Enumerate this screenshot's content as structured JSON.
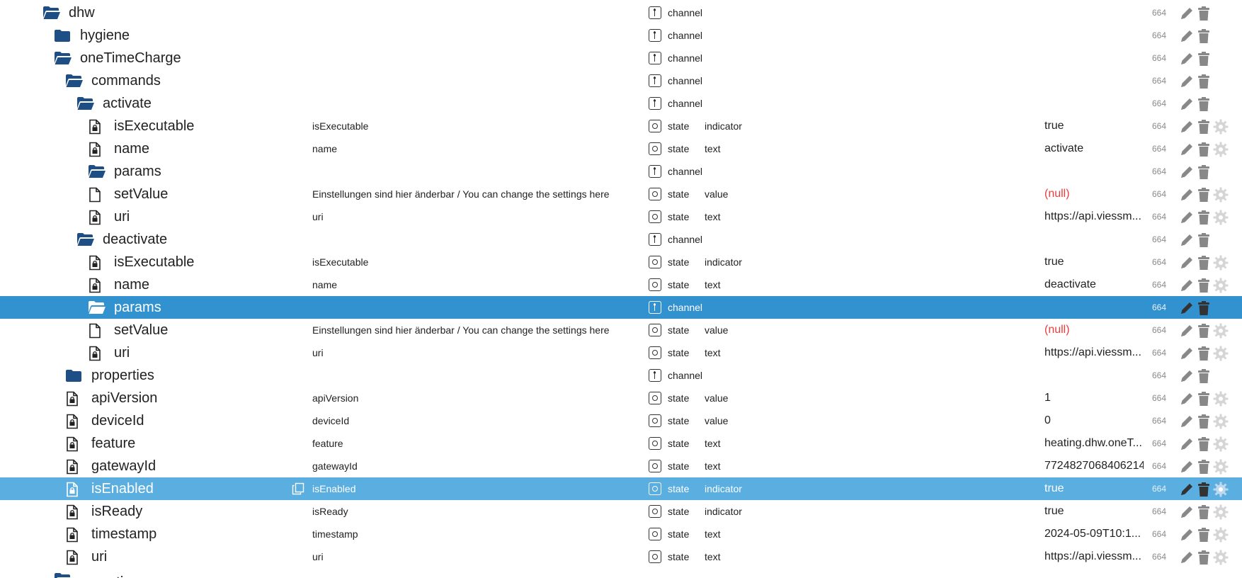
{
  "colors": {
    "folder": "#1d4f86",
    "selected_row": "#3291cf",
    "selected_row_light": "#5aaee0",
    "null_value": "#ee3b3b",
    "acl_text": "#8a8a8a",
    "action_icon": "#888888",
    "gear_icon": "#d6d6d6"
  },
  "rows": [
    {
      "name": "dhw",
      "icon": "folder-open",
      "indent": 0,
      "desc": "",
      "type": "channel",
      "role": "",
      "value": "",
      "acl": "664",
      "gear": false,
      "selected": ""
    },
    {
      "name": "hygiene",
      "icon": "folder-closed",
      "indent": 1,
      "desc": "",
      "type": "channel",
      "role": "",
      "value": "",
      "acl": "664",
      "gear": false,
      "selected": ""
    },
    {
      "name": "oneTimeCharge",
      "icon": "folder-open",
      "indent": 1,
      "desc": "",
      "type": "channel",
      "role": "",
      "value": "",
      "acl": "664",
      "gear": false,
      "selected": ""
    },
    {
      "name": "commands",
      "icon": "folder-open",
      "indent": 2,
      "desc": "",
      "type": "channel",
      "role": "",
      "value": "",
      "acl": "664",
      "gear": false,
      "selected": ""
    },
    {
      "name": "activate",
      "icon": "folder-open",
      "indent": 3,
      "desc": "",
      "type": "channel",
      "role": "",
      "value": "",
      "acl": "664",
      "gear": false,
      "selected": ""
    },
    {
      "name": "isExecutable",
      "icon": "file-lock",
      "indent": 4,
      "desc": "isExecutable",
      "type": "state",
      "role": "indicator",
      "value": "true",
      "acl": "664",
      "gear": true,
      "selected": ""
    },
    {
      "name": "name",
      "icon": "file-lock",
      "indent": 4,
      "desc": "name",
      "type": "state",
      "role": "text",
      "value": "activate",
      "acl": "664",
      "gear": true,
      "selected": ""
    },
    {
      "name": "params",
      "icon": "folder-open",
      "indent": 4,
      "desc": "",
      "type": "channel",
      "role": "",
      "value": "",
      "acl": "664",
      "gear": false,
      "selected": ""
    },
    {
      "name": "setValue",
      "icon": "file",
      "indent": 4,
      "desc": "Einstellungen sind hier änderbar / You can change the settings here",
      "type": "state",
      "role": "value",
      "value": "(null)",
      "valueNull": true,
      "acl": "664",
      "gear": true,
      "selected": ""
    },
    {
      "name": "uri",
      "icon": "file-lock",
      "indent": 4,
      "desc": "uri",
      "type": "state",
      "role": "text",
      "value": "https://api.viessm...",
      "acl": "664",
      "gear": true,
      "selected": ""
    },
    {
      "name": "deactivate",
      "icon": "folder-open",
      "indent": 3,
      "desc": "",
      "type": "channel",
      "role": "",
      "value": "",
      "acl": "664",
      "gear": false,
      "selected": ""
    },
    {
      "name": "isExecutable",
      "icon": "file-lock",
      "indent": 4,
      "desc": "isExecutable",
      "type": "state",
      "role": "indicator",
      "value": "true",
      "acl": "664",
      "gear": true,
      "selected": ""
    },
    {
      "name": "name",
      "icon": "file-lock",
      "indent": 4,
      "desc": "name",
      "type": "state",
      "role": "text",
      "value": "deactivate",
      "acl": "664",
      "gear": true,
      "selected": ""
    },
    {
      "name": "params",
      "icon": "folder-open",
      "indent": 4,
      "desc": "",
      "type": "channel",
      "role": "",
      "value": "",
      "acl": "664",
      "gear": false,
      "selected": "dark"
    },
    {
      "name": "setValue",
      "icon": "file",
      "indent": 4,
      "desc": "Einstellungen sind hier änderbar / You can change the settings here",
      "type": "state",
      "role": "value",
      "value": "(null)",
      "valueNull": true,
      "acl": "664",
      "gear": true,
      "selected": ""
    },
    {
      "name": "uri",
      "icon": "file-lock",
      "indent": 4,
      "desc": "uri",
      "type": "state",
      "role": "text",
      "value": "https://api.viessm...",
      "acl": "664",
      "gear": true,
      "selected": ""
    },
    {
      "name": "properties",
      "icon": "folder-closed",
      "indent": 2,
      "desc": "",
      "type": "channel",
      "role": "",
      "value": "",
      "acl": "664",
      "gear": false,
      "selected": ""
    },
    {
      "name": "apiVersion",
      "icon": "file-lock",
      "indent": 2,
      "desc": "apiVersion",
      "type": "state",
      "role": "value",
      "value": "1",
      "acl": "664",
      "gear": true,
      "selected": ""
    },
    {
      "name": "deviceId",
      "icon": "file-lock",
      "indent": 2,
      "desc": "deviceId",
      "type": "state",
      "role": "value",
      "value": "0",
      "acl": "664",
      "gear": true,
      "selected": ""
    },
    {
      "name": "feature",
      "icon": "file-lock",
      "indent": 2,
      "desc": "feature",
      "type": "state",
      "role": "text",
      "value": "heating.dhw.oneT...",
      "acl": "664",
      "gear": true,
      "selected": ""
    },
    {
      "name": "gatewayId",
      "icon": "file-lock",
      "indent": 2,
      "desc": "gatewayId",
      "type": "state",
      "role": "text",
      "value": "7724827068406214",
      "acl": "664",
      "gear": true,
      "selected": ""
    },
    {
      "name": "isEnabled",
      "icon": "file-lock",
      "indent": 2,
      "desc": "isEnabled",
      "type": "state",
      "role": "indicator",
      "value": "true",
      "acl": "664",
      "gear": true,
      "selected": "light",
      "copy": true
    },
    {
      "name": "isReady",
      "icon": "file-lock",
      "indent": 2,
      "desc": "isReady",
      "type": "state",
      "role": "indicator",
      "value": "true",
      "acl": "664",
      "gear": true,
      "selected": ""
    },
    {
      "name": "timestamp",
      "icon": "file-lock",
      "indent": 2,
      "desc": "timestamp",
      "type": "state",
      "role": "text",
      "value": "2024-05-09T10:1...",
      "acl": "664",
      "gear": true,
      "selected": ""
    },
    {
      "name": "uri",
      "icon": "file-lock",
      "indent": 2,
      "desc": "uri",
      "type": "state",
      "role": "text",
      "value": "https://api.viessm...",
      "acl": "664",
      "gear": true,
      "selected": ""
    }
  ],
  "peek_row": {
    "name": "operating",
    "icon": "folder-open",
    "indent": 1
  }
}
